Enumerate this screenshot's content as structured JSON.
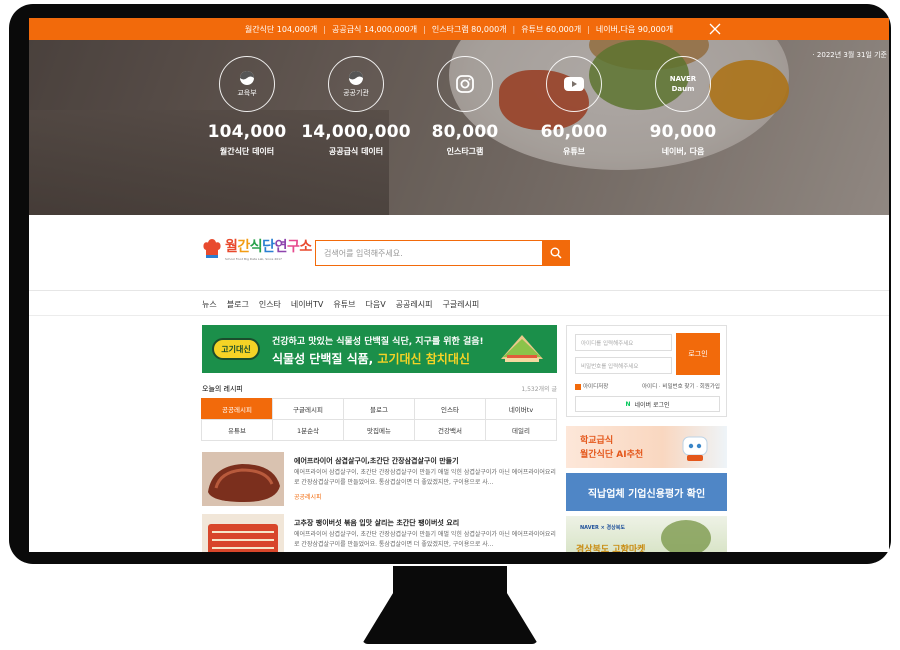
{
  "topbar": {
    "items": [
      "월간식단 104,000개",
      "공공급식 14,000,000개",
      "인스타그램 80,000개",
      "유튜브 60,000개",
      "네이버,다음 90,000개"
    ],
    "close_icon": "close-icon"
  },
  "hero": {
    "date": "· 2022년 3월 31일 기준",
    "stats": [
      {
        "icon": "mark",
        "label_in_circle": "교육부",
        "number": "104,000",
        "label": "월간식단 데이터"
      },
      {
        "icon": "mark",
        "label_in_circle": "공공기관",
        "number": "14,000,000",
        "label": "공공급식 데이터"
      },
      {
        "icon": "instagram-icon",
        "label_in_circle": "",
        "number": "80,000",
        "label": "인스타그램"
      },
      {
        "icon": "youtube-icon",
        "label_in_circle": "",
        "number": "60,000",
        "label": "유튜브"
      },
      {
        "icon": "naver-daum",
        "label_in_circle": "NAVER",
        "label_in_circle2": "Daum",
        "number": "90,000",
        "label": "네이버, 다음"
      }
    ]
  },
  "logo": {
    "chars": [
      "월",
      "간",
      "식",
      "단",
      "연",
      "구",
      "소"
    ],
    "sub": "School Food Big Data Lab, Since 2017"
  },
  "search": {
    "placeholder": "검색어를 입력해주세요."
  },
  "nav": {
    "items": [
      "뉴스",
      "블로그",
      "인스타",
      "네이버TV",
      "유튜브",
      "다음V",
      "공공레시피",
      "구글레시피"
    ]
  },
  "banner": {
    "badge": "고기대신",
    "line1": "건강하고 맛있는 식물성 단백질 식단, 지구를 위한 걸음!",
    "line2_pre": "식물성 단백질 식품, ",
    "line2_hl": "고기대신 참치대신"
  },
  "today": {
    "title": "오늘의 레시피",
    "count": "1,532개의 글"
  },
  "tabs": {
    "row1": [
      "공공레시피",
      "구글레시피",
      "블로그",
      "인스타",
      "네이버tv"
    ],
    "row2": [
      "유튜브",
      "1분순삭",
      "맛집메뉴",
      "건강백서",
      "데일리"
    ]
  },
  "articles": [
    {
      "title": "에어프라이어 삼겹살구이,초간단 간장삼겹살구이 만들기",
      "desc": "에어프라이어 삼겹살구이, 초간단 간장삼겹살구이 만들기 애벌 익힌 삼겹살구이가 아닌 에어프라이어요리로 간장삼겹살구이를 만들었어요. 통삼겹살이면 더 좋았겠지만, 구이용으로 사...",
      "category": "공공레시피"
    },
    {
      "title": "고추장 팽이버섯 볶음 입맛 살리는 초간단 팽이버섯 요리",
      "desc": "에어프라이어 삼겹살구이, 초간단 간장삼겹살구이 만들기 애벌 익힌 삼겹살구이가 아닌 에어프라이어요리로 간장삼겹살구이를 만들었어요. 통삼겹살이면 더 좋았겠지만, 구이용으로 사...",
      "category": ""
    }
  ],
  "login": {
    "id_placeholder": "아이디를 입력해주세요",
    "pw_placeholder": "비밀번호를 입력해주세요",
    "button": "로그인",
    "remember": "아이디저장",
    "links": "아이디 · 비밀번호 찾기 · 회원가입",
    "naver": "네이버 로그인"
  },
  "ads": {
    "ad1_line1": "학교급식",
    "ad1_line2": "월간식단 AI추천",
    "ad2": "직납업체 기업신용평가 확인",
    "ad3_top": "NAVER × 경상북도",
    "ad3_bottom": "경상북도 고향마켓"
  },
  "colors": {
    "accent": "#f26a0b",
    "banner_green": "#1b8f4a",
    "ad_blue": "#4f86c6"
  }
}
